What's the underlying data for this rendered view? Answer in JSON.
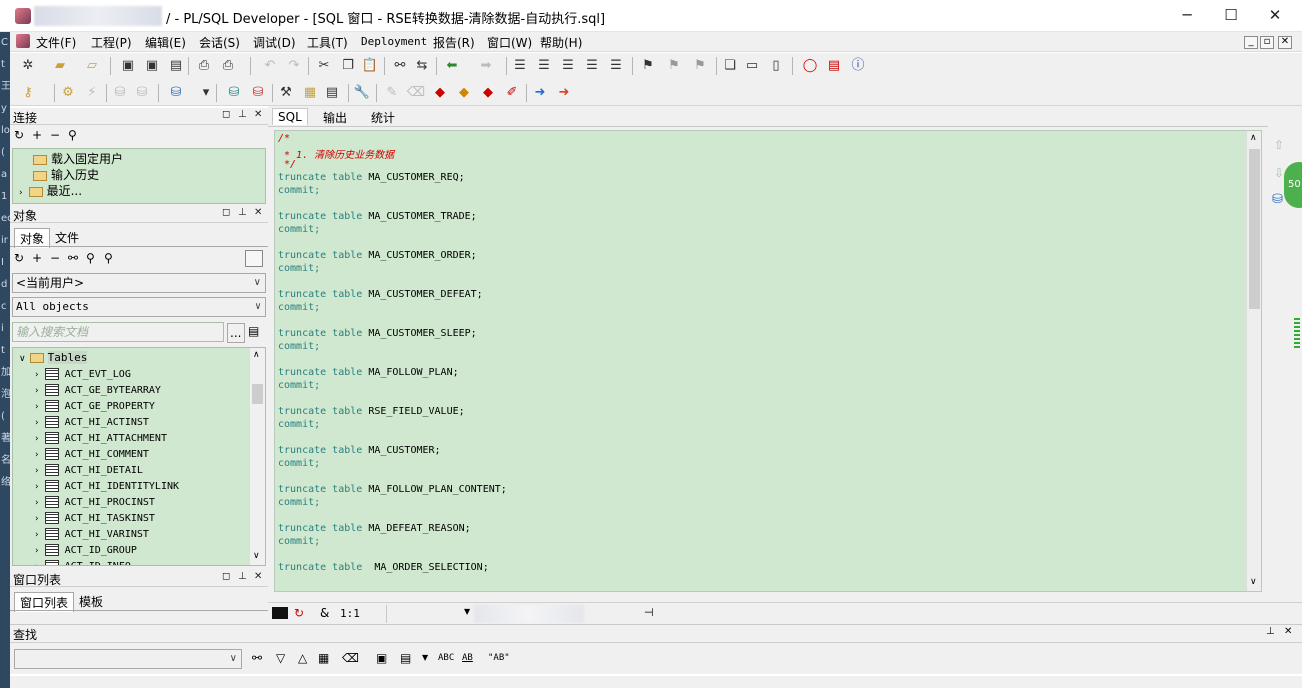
{
  "window": {
    "title": "/ - PL/SQL Developer - [SQL 窗口 - RSE转换数据-清除数据-自动执行.sql]",
    "minimize": "─",
    "maximize": "☐",
    "close": "✕"
  },
  "left_strip_chars": [
    "C",
    "t",
    "王",
    "y",
    "lo",
    "(",
    "a",
    "1",
    "ec",
    "ir",
    "I",
    "d",
    "c",
    "i",
    "t",
    "加",
    "泡",
    "(",
    "著",
    "名",
    "络"
  ],
  "menu": [
    "文件(F)",
    "工程(P)",
    "编辑(E)",
    "会话(S)",
    "调试(D)",
    "工具(T)",
    "Deployment",
    "报告(R)",
    "窗口(W)",
    "帮助(H)"
  ],
  "mdi_controls": [
    "_",
    "▫",
    "✕"
  ],
  "connections_panel": {
    "title": "连接",
    "items": [
      {
        "label": "载入固定用户",
        "icon": "folder-icon"
      },
      {
        "label": "输入历史",
        "icon": "folder-icon"
      },
      {
        "label": "最近...",
        "icon": "folder-icon"
      }
    ]
  },
  "objects_panel": {
    "title": "对象",
    "tabs": [
      "对象",
      "文件"
    ],
    "user_select": "<当前用户>",
    "filter_select": "All objects",
    "search_placeholder": "输入搜索文档",
    "search_more": "...",
    "root": "Tables",
    "tables": [
      "ACT_EVT_LOG",
      "ACT_GE_BYTEARRAY",
      "ACT_GE_PROPERTY",
      "ACT_HI_ACTINST",
      "ACT_HI_ATTACHMENT",
      "ACT_HI_COMMENT",
      "ACT_HI_DETAIL",
      "ACT_HI_IDENTITYLINK",
      "ACT_HI_PROCINST",
      "ACT_HI_TASKINST",
      "ACT_HI_VARINST",
      "ACT_ID_GROUP",
      "ACT_ID_INFO"
    ]
  },
  "window_list_panel": {
    "title": "窗口列表",
    "tabs": [
      "窗口列表",
      "模板"
    ]
  },
  "editor": {
    "tabs": [
      "SQL",
      "输出",
      "统计"
    ],
    "lines": [
      {
        "t": "/*",
        "c": "cm"
      },
      {
        "t": " * 1. 清除历史业务数据",
        "c": "cm"
      },
      {
        "t": " */",
        "c": "cm"
      },
      {
        "kw": "truncate table ",
        "id": "MA_CUSTOMER_REQ;"
      },
      {
        "kw": "commit;",
        "id": ""
      },
      {
        "t": "",
        "c": ""
      },
      {
        "kw": "truncate table ",
        "id": "MA_CUSTOMER_TRADE;"
      },
      {
        "kw": "commit;",
        "id": ""
      },
      {
        "t": "",
        "c": ""
      },
      {
        "kw": "truncate table ",
        "id": "MA_CUSTOMER_ORDER;"
      },
      {
        "kw": "commit;",
        "id": ""
      },
      {
        "t": "",
        "c": ""
      },
      {
        "kw": "truncate table ",
        "id": "MA_CUSTOMER_DEFEAT;"
      },
      {
        "kw": "commit;",
        "id": ""
      },
      {
        "t": "",
        "c": ""
      },
      {
        "kw": "truncate table ",
        "id": "MA_CUSTOMER_SLEEP;"
      },
      {
        "kw": "commit;",
        "id": ""
      },
      {
        "t": "",
        "c": ""
      },
      {
        "kw": "truncate table ",
        "id": "MA_FOLLOW_PLAN;"
      },
      {
        "kw": "commit;",
        "id": ""
      },
      {
        "t": "",
        "c": ""
      },
      {
        "kw": "truncate table ",
        "id": "RSE_FIELD_VALUE;"
      },
      {
        "kw": "commit;",
        "id": ""
      },
      {
        "t": "",
        "c": ""
      },
      {
        "kw": "truncate table ",
        "id": "MA_CUSTOMER;"
      },
      {
        "kw": "commit;",
        "id": ""
      },
      {
        "t": "",
        "c": ""
      },
      {
        "kw": "truncate table ",
        "id": "MA_FOLLOW_PLAN_CONTENT;"
      },
      {
        "kw": "commit;",
        "id": ""
      },
      {
        "t": "",
        "c": ""
      },
      {
        "kw": "truncate table ",
        "id": "MA_DEFEAT_REASON;"
      },
      {
        "kw": "commit;",
        "id": ""
      },
      {
        "t": "",
        "c": ""
      },
      {
        "kw": "truncate table  ",
        "id": "MA_ORDER_SELECTION;"
      }
    ]
  },
  "status": {
    "position": "1:1",
    "ampersand": "&"
  },
  "find_panel": {
    "title": "查找",
    "abc1": "ABC",
    "abc2": "AB",
    "abc3": "\"AB\""
  },
  "side_badge": "50"
}
